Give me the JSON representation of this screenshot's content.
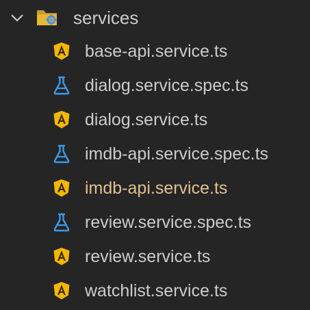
{
  "folder": {
    "name": "services",
    "expanded": true,
    "chevron_icon": "chevron-down-icon",
    "icon": "folder-services-icon",
    "icon_color": "#e8b536",
    "gear_color": "#4a90e2"
  },
  "colors": {
    "background": "#252526",
    "text": "#cccccc",
    "modified_text": "#e2c08d",
    "angular_icon": "#f2b705",
    "test_icon": "#3c9ae8"
  },
  "files": [
    {
      "name": "base-api.service.ts",
      "icon": "angular-service-icon",
      "modified": false
    },
    {
      "name": "dialog.service.spec.ts",
      "icon": "flask-test-icon",
      "modified": false
    },
    {
      "name": "dialog.service.ts",
      "icon": "angular-service-icon",
      "modified": false
    },
    {
      "name": "imdb-api.service.spec.ts",
      "icon": "flask-test-icon",
      "modified": false
    },
    {
      "name": "imdb-api.service.ts",
      "icon": "angular-service-icon",
      "modified": true
    },
    {
      "name": "review.service.spec.ts",
      "icon": "flask-test-icon",
      "modified": false
    },
    {
      "name": "review.service.ts",
      "icon": "angular-service-icon",
      "modified": false
    },
    {
      "name": "watchlist.service.ts",
      "icon": "angular-service-icon",
      "modified": false
    }
  ]
}
